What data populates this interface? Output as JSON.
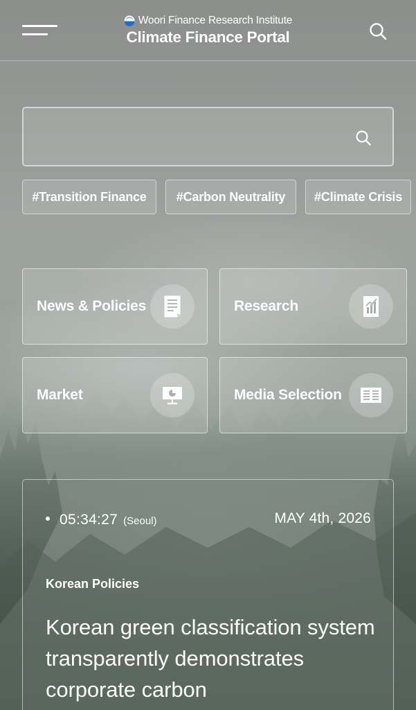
{
  "header": {
    "institute": "Woori Finance Research Institute",
    "title": "Climate Finance Portal"
  },
  "search": {
    "placeholder": ""
  },
  "tags": [
    "#Transition Finance",
    "#Carbon Neutrality",
    "#Climate Crisis"
  ],
  "categories": [
    {
      "label": "News & Policies",
      "icon": "document-icon"
    },
    {
      "label": "Research",
      "icon": "chart-report-icon"
    },
    {
      "label": "Market",
      "icon": "presentation-board-icon"
    },
    {
      "label": "Media Selection",
      "icon": "newspaper-icon"
    }
  ],
  "news": {
    "time": "05:34:27",
    "city": "(Seoul)",
    "date": "MAY 4th, 2026",
    "category": "Korean Policies",
    "headline": "Korean green classification system transparently demonstrates corporate carbon"
  },
  "colors": {
    "brand_logo_blue": "#1f6fc6",
    "text": "#ffffff"
  }
}
